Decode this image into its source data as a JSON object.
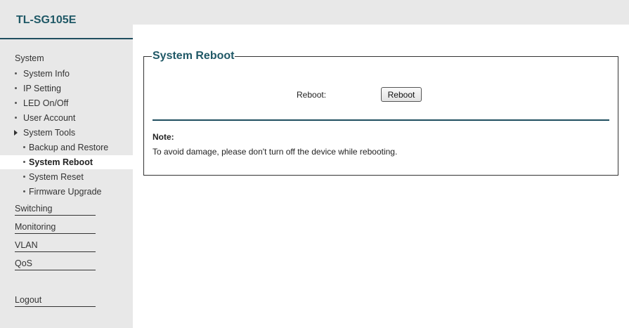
{
  "app": {
    "title": "TL-SG105E"
  },
  "sidebar": {
    "system_label": "System",
    "system_items": [
      {
        "label": "System Info"
      },
      {
        "label": "IP Setting"
      },
      {
        "label": "LED On/Off"
      },
      {
        "label": "User Account"
      },
      {
        "label": "System Tools"
      }
    ],
    "tools_items": [
      {
        "label": "Backup and Restore"
      },
      {
        "label": "System Reboot"
      },
      {
        "label": "System Reset"
      },
      {
        "label": "Firmware Upgrade"
      }
    ],
    "sections": [
      {
        "label": "Switching"
      },
      {
        "label": "Monitoring"
      },
      {
        "label": "VLAN"
      },
      {
        "label": "QoS"
      }
    ],
    "logout_label": "Logout"
  },
  "panel": {
    "legend": "System Reboot",
    "reboot_label": "Reboot:",
    "reboot_button": "Reboot",
    "note_title": "Note:",
    "note_text": "To avoid damage, please don't turn off the device while rebooting."
  }
}
